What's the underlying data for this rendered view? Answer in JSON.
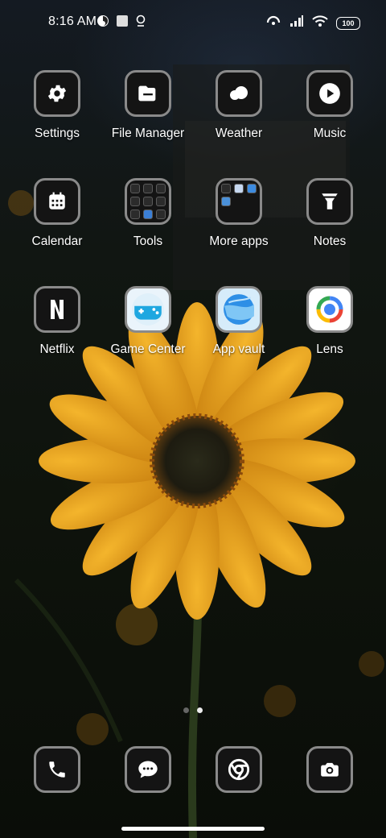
{
  "status_bar": {
    "time": "8:16 AM",
    "left_icons": [
      "firefox-icon",
      "square-notification-icon",
      "location-pin-icon"
    ],
    "right_icons": [
      "hotspot-icon",
      "signal-icon",
      "wifi-icon",
      "battery-icon"
    ],
    "battery": "100"
  },
  "apps": {
    "row1": [
      {
        "label": "Settings",
        "icon": "gear-icon"
      },
      {
        "label": "File Manager",
        "icon": "folder-icon"
      },
      {
        "label": "Weather",
        "icon": "cloud-icon"
      },
      {
        "label": "Music",
        "icon": "play-icon"
      }
    ],
    "row2": [
      {
        "label": "Calendar",
        "icon": "calendar-icon"
      },
      {
        "label": "Tools",
        "icon": "folder-grid-icon"
      },
      {
        "label": "More apps",
        "icon": "folder-grid-icon"
      },
      {
        "label": "Notes",
        "icon": "notes-icon"
      }
    ],
    "row3": [
      {
        "label": "Netflix",
        "icon": "netflix-icon"
      },
      {
        "label": "Game Center",
        "icon": "gamepad-icon"
      },
      {
        "label": "App vault",
        "icon": "app-vault-icon"
      },
      {
        "label": "Lens",
        "icon": "lens-icon"
      }
    ]
  },
  "page_indicator": {
    "total": 2,
    "active": 2
  },
  "dock": [
    {
      "icon": "phone-icon"
    },
    {
      "icon": "messages-icon"
    },
    {
      "icon": "chrome-icon"
    },
    {
      "icon": "camera-icon"
    }
  ],
  "colors": {
    "accent_flower": "#e8a21a",
    "tile_border": "#8a8a8a"
  }
}
